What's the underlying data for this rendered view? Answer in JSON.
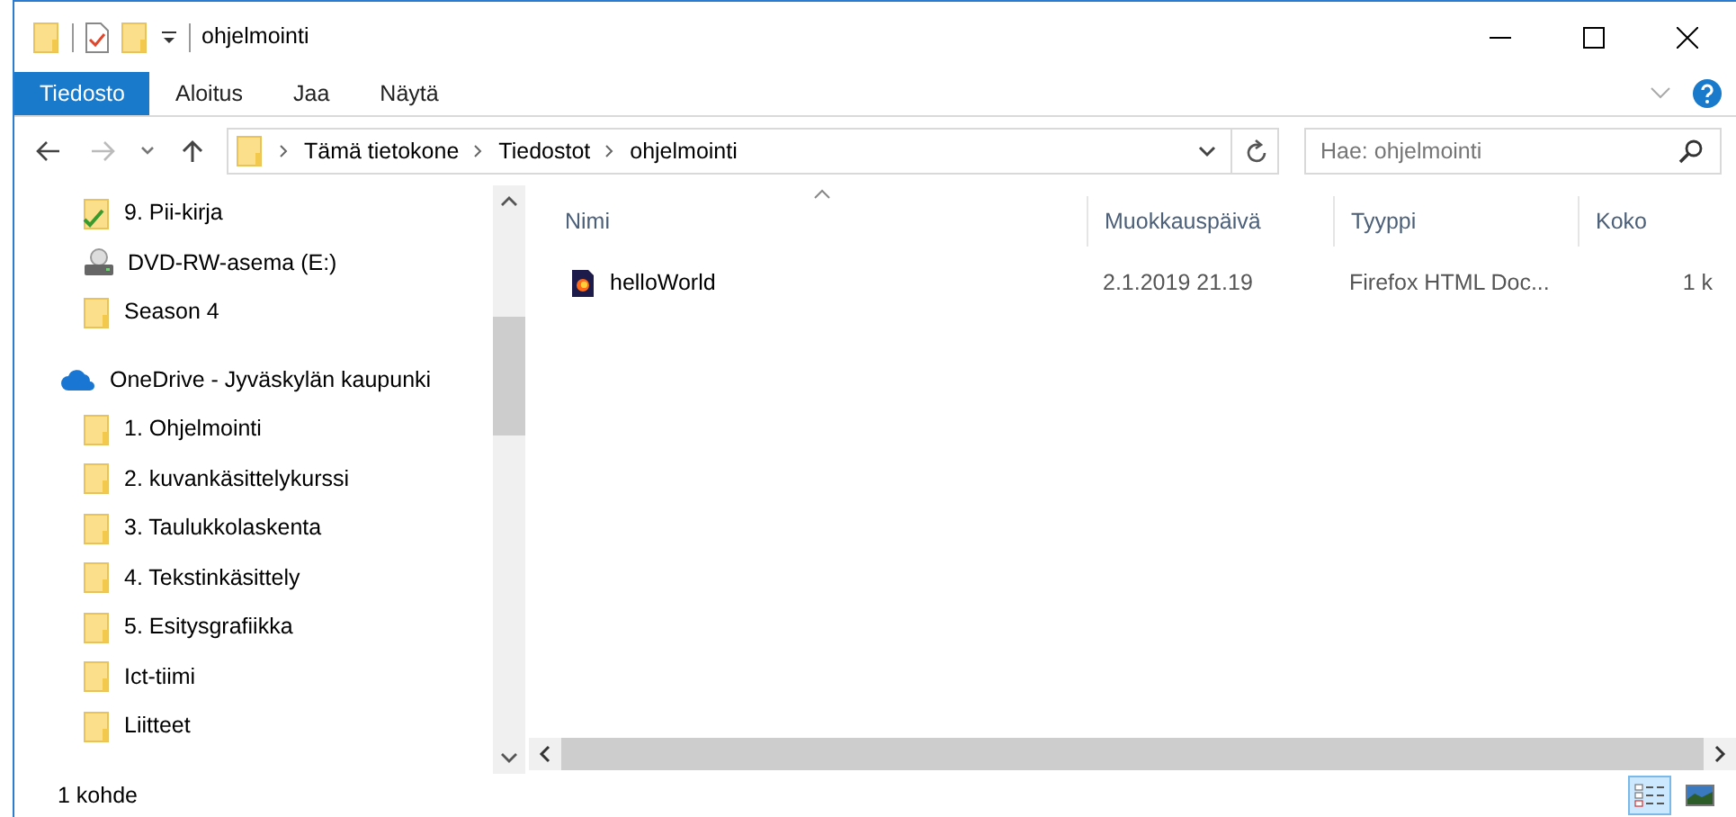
{
  "window": {
    "title": "ohjelmointi"
  },
  "ribbon_tabs": [
    {
      "label": "Tiedosto",
      "kind": "file",
      "selected": false
    },
    {
      "label": "Aloitus",
      "kind": "tab",
      "selected": false
    },
    {
      "label": "Jaa",
      "kind": "tab",
      "selected": false
    },
    {
      "label": "Näytä",
      "kind": "tab",
      "selected": false
    }
  ],
  "address_bar": {
    "path": [
      "Tämä tietokone",
      "Tiedostot",
      "ohjelmointi"
    ]
  },
  "search": {
    "placeholder": "Hae: ohjelmointi"
  },
  "sidebar": {
    "items": [
      {
        "label": "9. Pii-kirja",
        "kind": "synced"
      },
      {
        "label": "DVD-RW-asema (E:)",
        "kind": "drive"
      },
      {
        "label": "Season 4",
        "kind": "folder"
      },
      {
        "label": "OneDrive - Jyväskylän kaupunki",
        "kind": "cloud"
      },
      {
        "label": "1. Ohjelmointi",
        "kind": "folder"
      },
      {
        "label": "2. kuvankäsittelykurssi",
        "kind": "folder"
      },
      {
        "label": "3. Taulukkolaskenta",
        "kind": "folder"
      },
      {
        "label": "4. Tekstinkäsittely",
        "kind": "folder"
      },
      {
        "label": "5. Esitysgrafiikka",
        "kind": "folder"
      },
      {
        "label": "Ict-tiimi",
        "kind": "folder"
      },
      {
        "label": "Liitteet",
        "kind": "folder"
      }
    ]
  },
  "table": {
    "columns": [
      "Nimi",
      "Muokkauspäivä",
      "Tyyppi",
      "Koko"
    ],
    "rows": [
      {
        "cells": [
          "helloWorld",
          "2.1.2019 21.19",
          "Firefox HTML Doc...",
          "1 k"
        ]
      }
    ]
  },
  "status_bar": {
    "text": "1 kohde",
    "views": [
      {
        "kind": "details",
        "selected": true
      },
      {
        "kind": "large-icons",
        "selected": false
      }
    ]
  }
}
